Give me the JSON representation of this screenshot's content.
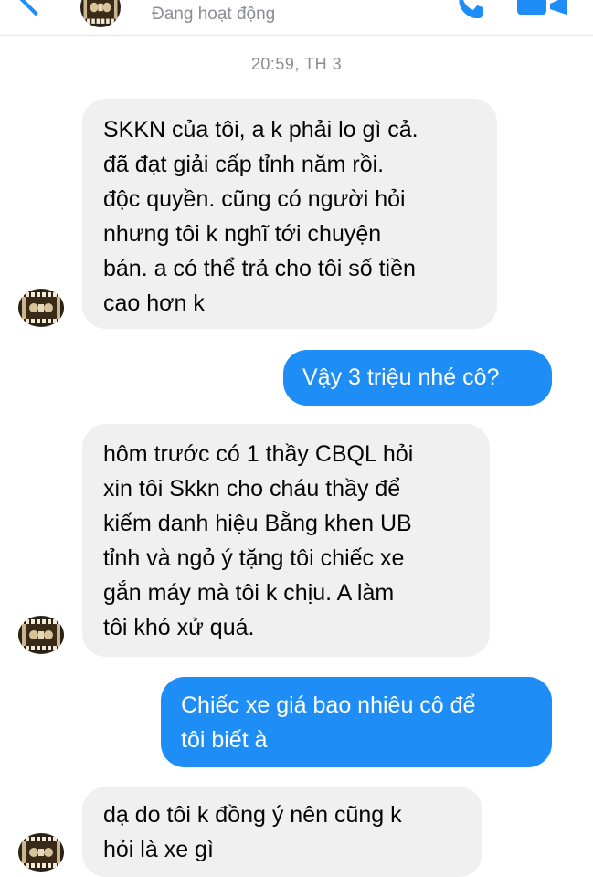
{
  "header": {
    "status": "Đang hoạt động"
  },
  "icons": {
    "back": "chevron-left-icon",
    "call": "phone-icon",
    "video": "video-camera-icon",
    "avatar": "contact-avatar"
  },
  "colors": {
    "accent": "#1e8ef6",
    "incoming_bg": "#f0f0f0",
    "outgoing_text": "#ffffff",
    "meta_text": "#8a8d91"
  },
  "timestamp": "20:59, TH 3",
  "messages": [
    {
      "from": "other",
      "text": "SKKN của tôi, a k phải lo gì cả.\nđã đạt giải cấp tỉnh năm rồi.\nđộc quyền. cũng có người hỏi\nnhưng tôi k nghĩ tới chuyện\nbán. a có thể trả cho tôi số tiền\ncao hơn k"
    },
    {
      "from": "me",
      "text": "Vậy 3 triệu nhé cô?"
    },
    {
      "from": "other",
      "text": "hôm trước có 1 thầy CBQL hỏi\nxin tôi Skkn cho cháu thầy để\nkiếm danh hiệu Bằng khen UB\ntỉnh và ngỏ ý tặng tôi chiếc xe\ngắn máy mà tôi k chịu. A làm\ntôi khó xử quá."
    },
    {
      "from": "me",
      "text": "Chiếc xe giá bao nhiêu cô để\ntôi biết à"
    },
    {
      "from": "other",
      "text": "dạ do tôi k đồng ý nên cũng k\nhỏi là xe gì"
    }
  ]
}
